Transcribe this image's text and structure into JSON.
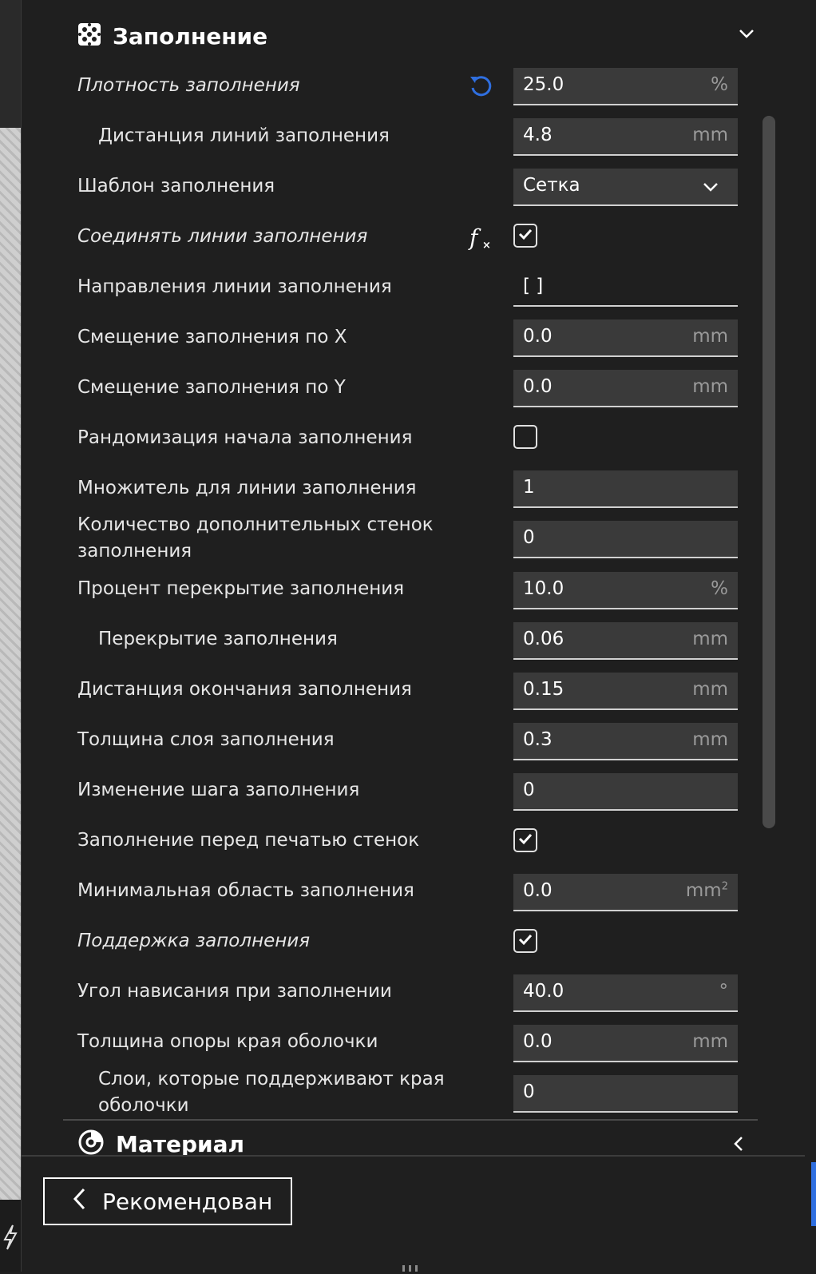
{
  "section": {
    "title": "Заполнение",
    "icon": "infill-icon",
    "expanded": true
  },
  "settings": [
    {
      "label": "Плотность заполнения",
      "italic": true,
      "indent": false,
      "type": "number",
      "value": "25.0",
      "unit": "%",
      "aux": "reset-icon"
    },
    {
      "label": "Дистанция линий заполнения",
      "italic": false,
      "indent": true,
      "type": "number",
      "value": "4.8",
      "unit": "mm"
    },
    {
      "label": "Шаблон заполнения",
      "italic": false,
      "indent": false,
      "type": "select",
      "value": "Сетка"
    },
    {
      "label": "Соединять линии заполнения",
      "italic": true,
      "indent": false,
      "type": "checkbox",
      "checked": true,
      "aux": "function-icon"
    },
    {
      "label": "Направления линии заполнения",
      "italic": false,
      "indent": false,
      "type": "text",
      "value": "[ ]"
    },
    {
      "label": "Смещение заполнения по X",
      "italic": false,
      "indent": false,
      "type": "number",
      "value": "0.0",
      "unit": "mm"
    },
    {
      "label": "Смещение заполнения по Y",
      "italic": false,
      "indent": false,
      "type": "number",
      "value": "0.0",
      "unit": "mm"
    },
    {
      "label": "Рандомизация начала заполнения",
      "italic": false,
      "indent": false,
      "type": "checkbox",
      "checked": false
    },
    {
      "label": "Множитель для линии заполнения",
      "italic": false,
      "indent": false,
      "type": "number",
      "value": "1",
      "unit": ""
    },
    {
      "label": "Количество дополнительных стенок заполнения",
      "italic": false,
      "indent": false,
      "type": "number",
      "value": "0",
      "unit": ""
    },
    {
      "label": "Процент перекрытие заполнения",
      "italic": false,
      "indent": false,
      "type": "number",
      "value": "10.0",
      "unit": "%"
    },
    {
      "label": "Перекрытие заполнения",
      "italic": false,
      "indent": true,
      "type": "number",
      "value": "0.06",
      "unit": "mm"
    },
    {
      "label": "Дистанция окончания заполнения",
      "italic": false,
      "indent": false,
      "type": "number",
      "value": "0.15",
      "unit": "mm"
    },
    {
      "label": "Толщина слоя заполнения",
      "italic": false,
      "indent": false,
      "type": "number",
      "value": "0.3",
      "unit": "mm"
    },
    {
      "label": "Изменение шага заполнения",
      "italic": false,
      "indent": false,
      "type": "number",
      "value": "0",
      "unit": ""
    },
    {
      "label": "Заполнение перед печатью стенок",
      "italic": false,
      "indent": false,
      "type": "checkbox",
      "checked": true
    },
    {
      "label": "Минимальная область заполнения",
      "italic": false,
      "indent": false,
      "type": "number",
      "value": "0.0",
      "unit": "mm",
      "unit_sup": "2"
    },
    {
      "label": "Поддержка заполнения",
      "italic": true,
      "indent": false,
      "type": "checkbox",
      "checked": true
    },
    {
      "label": "Угол нависания при заполнении",
      "italic": false,
      "indent": false,
      "type": "number",
      "value": "40.0",
      "unit": "°"
    },
    {
      "label": "Толщина опоры края оболочки",
      "italic": false,
      "indent": false,
      "type": "number",
      "value": "0.0",
      "unit": "mm"
    },
    {
      "label": "Слои, которые поддерживают края оболочки",
      "italic": false,
      "indent": true,
      "type": "number",
      "value": "0",
      "unit": ""
    }
  ],
  "material_section": {
    "title": "Материал",
    "icon": "material-icon",
    "expanded": false
  },
  "footer": {
    "recommended_label": "Рекомендован"
  },
  "colors": {
    "accent": "#2f6fe0",
    "panel_bg": "#1f1f1f",
    "field_bg": "#3a3a3a"
  }
}
